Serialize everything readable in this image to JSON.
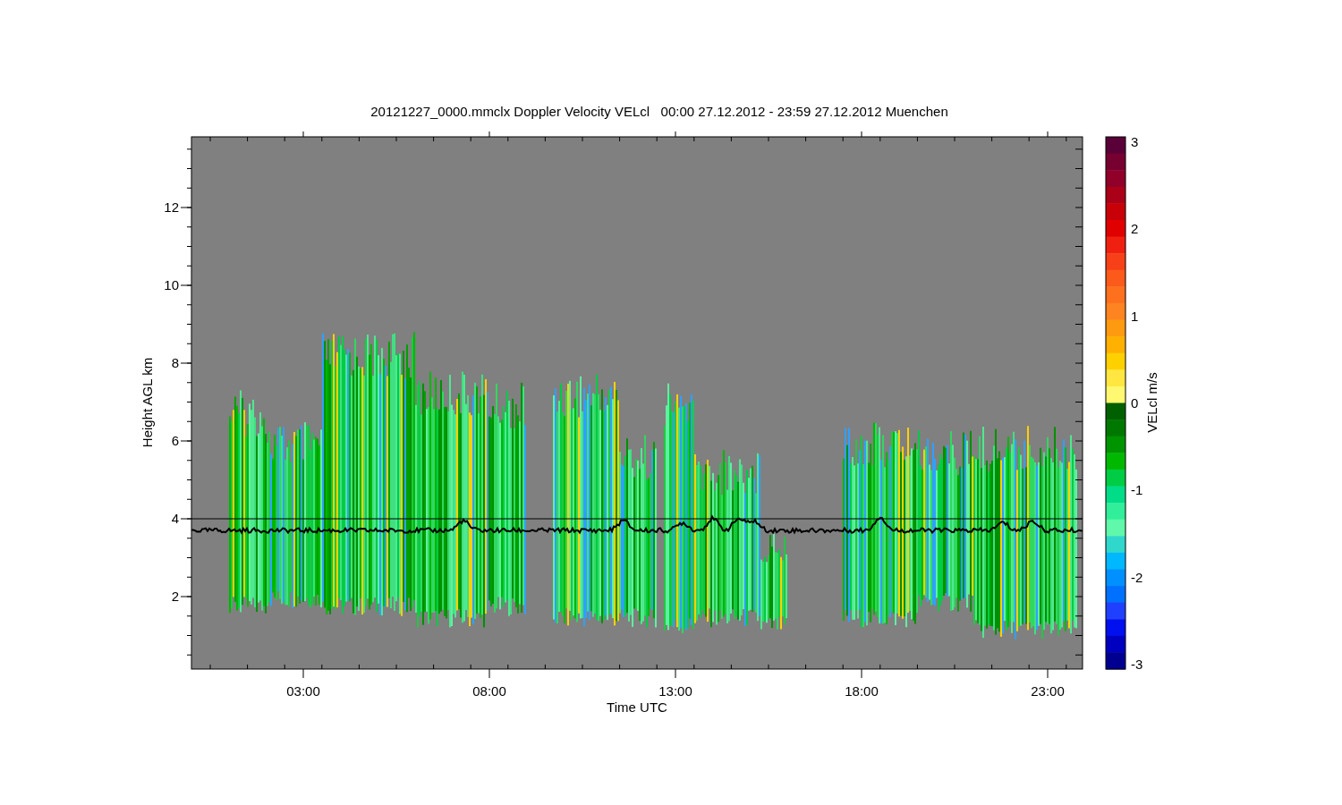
{
  "plot": {
    "title": "20121227_0000.mmclx Doppler Velocity VELcl   00:00 27.12.2012 - 23:59 27.12.2012 Muenchen",
    "y_axis": {
      "label": "Height AGL km",
      "ticks": [
        "12",
        "10",
        "8",
        "6",
        "4",
        "2"
      ]
    },
    "x_axis": {
      "label": "Time UTC",
      "ticks": [
        "03:00",
        "08:00",
        "13:00",
        "18:00",
        "23:00"
      ]
    },
    "colorbar": {
      "label": "VELcl m/s",
      "ticks": [
        "3",
        "2",
        "1",
        "0",
        "-1",
        "-2",
        "-3"
      ]
    }
  }
}
